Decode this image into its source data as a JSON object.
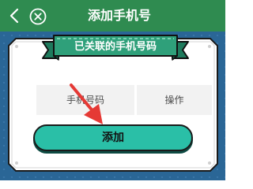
{
  "header": {
    "title": "添加手机号",
    "back_icon": "chevron-left-icon",
    "close_icon": "circle-x-icon"
  },
  "section": {
    "title": "已关联的手机号码"
  },
  "table": {
    "columns": [
      "手机号码",
      "操作"
    ]
  },
  "actions": {
    "add_label": "添加"
  },
  "colors": {
    "top_bar": "#2F8B50",
    "background": "#2A6696",
    "ribbon": "#2FA07A",
    "button": "#2ABFA7",
    "arrow": "#E53935"
  }
}
